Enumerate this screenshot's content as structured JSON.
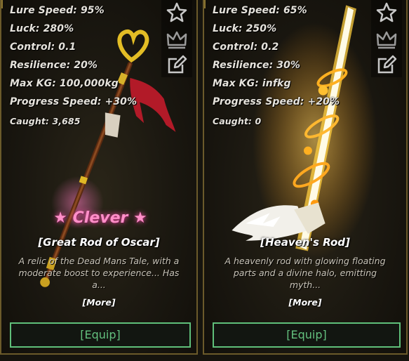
{
  "cards": [
    {
      "stats": {
        "lure_speed": "Lure Speed: 95%",
        "luck": "Luck: 280%",
        "control": "Control: 0.1",
        "resilience": "Resilience: 20%",
        "max_kg": "Max KG: 100,000kg",
        "progress_speed": "Progress Speed: +30%",
        "caught": "Caught: 3,685"
      },
      "rarity": "★ Clever ★",
      "name": "[Great Rod of Oscar]",
      "description": "A relic of the Dead Mans Tale, with a moderate boost to experience... Has a...",
      "more_label": "[More]",
      "equip_label": "[Equip]",
      "icons": [
        "star-icon",
        "crown-icon",
        "edit-icon"
      ]
    },
    {
      "stats": {
        "lure_speed": "Lure Speed: 65%",
        "luck": "Luck: 250%",
        "control": "Control: 0.2",
        "resilience": "Resilience: 30%",
        "max_kg": "Max KG: infkg",
        "progress_speed": "Progress Speed: +20%",
        "caught": "Caught: 0"
      },
      "name": "[Heaven's Rod]",
      "description": "A heavenly rod with glowing floating parts and a divine halo, emitting myth...",
      "more_label": "[More]",
      "equip_label": "[Equip]",
      "icons": [
        "star-icon",
        "crown-icon",
        "edit-icon"
      ]
    }
  ],
  "colors": {
    "stat_text": "#e6e3dc",
    "rarity_pink": "#ff8fc8",
    "equip_green": "#63c07e",
    "card_border": "#6b5a2a"
  }
}
